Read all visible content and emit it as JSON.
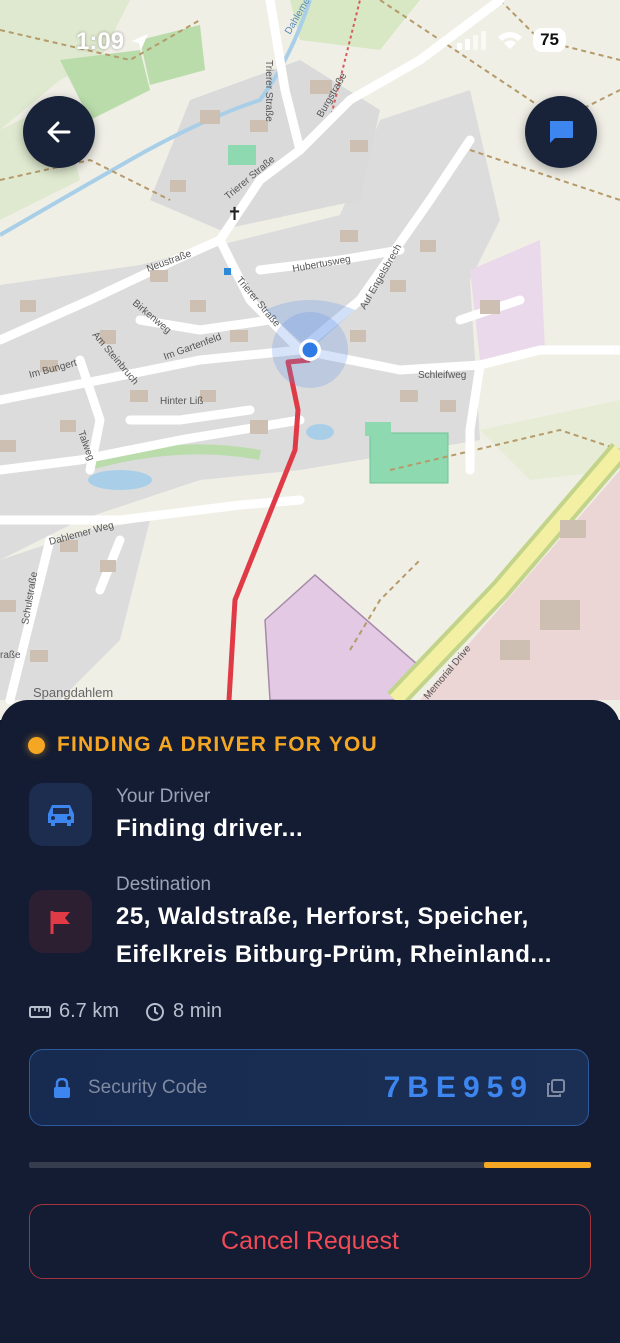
{
  "status_bar": {
    "time": "1:09",
    "battery": "75"
  },
  "map": {
    "streets": [
      "Trierer Straße",
      "Burgstraße",
      "Dahlemer",
      "Trierer Straße",
      "Neustraße",
      "Hubertusweg",
      "Trierer Straße",
      "Auf Engelsbrech",
      "Birkenweg",
      "Am Steinbruch",
      "Im Gartenfeld",
      "Im Bungert",
      "Schleifweg",
      "Hinter Liß",
      "Talweg",
      "Dahlemer Weg",
      "Schulstraße",
      "raße",
      "Memorial Drive"
    ],
    "place": "Spangdahlem",
    "route_color": "#e03a46"
  },
  "trip": {
    "status": "FINDING A DRIVER FOR YOU",
    "driver_label": "Your Driver",
    "driver_value": "Finding driver...",
    "destination_label": "Destination",
    "destination_line1": "25, Waldstraße, Herforst, Speicher,",
    "destination_line2": "Eifelkreis Bitburg-Prüm, Rheinland...",
    "distance": "6.7 km",
    "duration": "8 min",
    "security_label": "Security Code",
    "security_code": "7BE959",
    "progress_start": 0.0,
    "progress_end": 0.19,
    "cancel_label": "Cancel Request"
  },
  "colors": {
    "accent": "#f5a623",
    "primary": "#3d86f0",
    "danger": "#ef4a55",
    "sheet": "#131c33"
  },
  "icons": {
    "back": "arrow-left-icon",
    "chat": "chat-bubble-icon",
    "car": "car-icon",
    "flag": "flag-icon",
    "ruler": "ruler-icon",
    "clock": "clock-icon",
    "lock": "lock-icon",
    "copy": "copy-icon",
    "location": "location-arrow-icon"
  }
}
